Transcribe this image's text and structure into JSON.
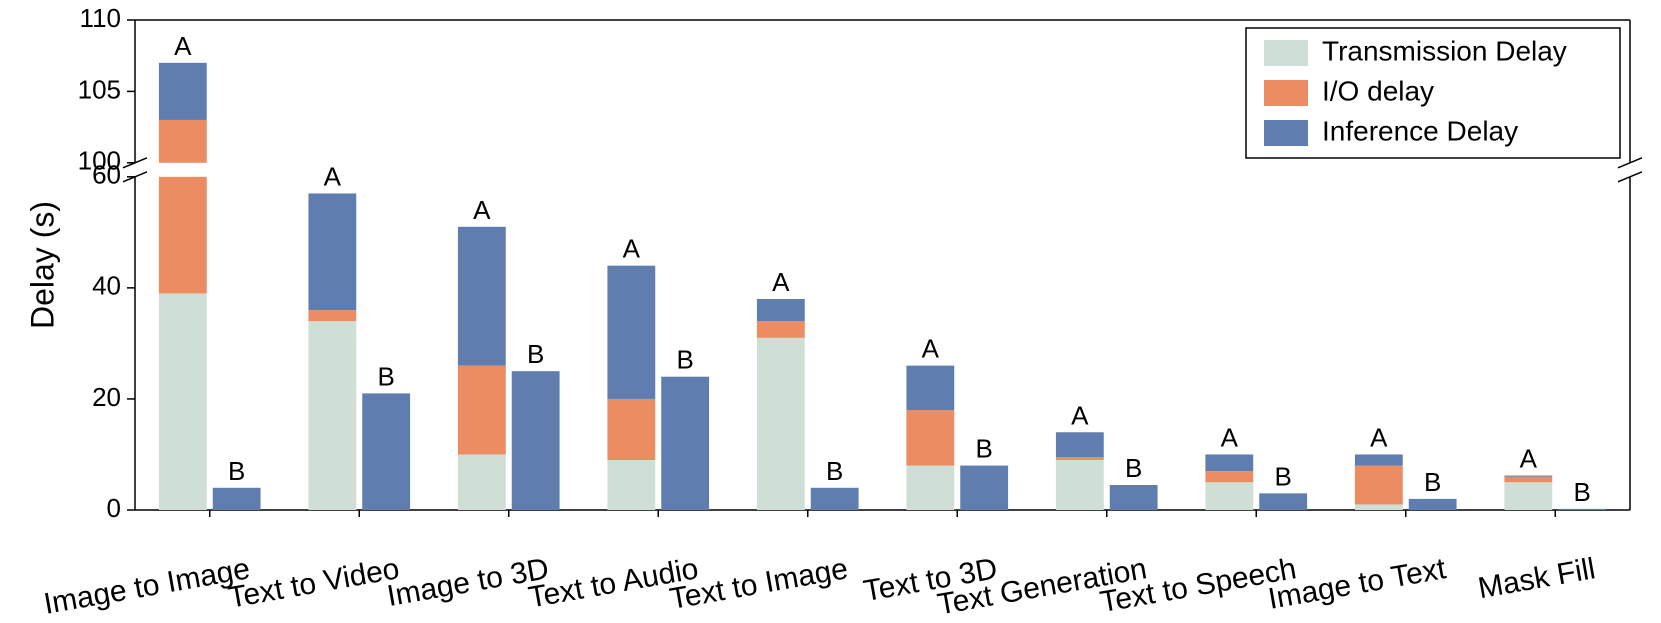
{
  "chart_data": {
    "type": "bar",
    "stacked": true,
    "ylabel": "Delay (s)",
    "xlabel": "",
    "group_labels": [
      "A",
      "B"
    ],
    "ylim_lower": [
      0,
      60
    ],
    "ylim_upper": [
      100,
      110
    ],
    "yticks_lower": [
      0,
      20,
      40,
      60
    ],
    "yticks_upper": [
      100,
      105,
      110
    ],
    "categories": [
      "Image to Image",
      "Text to Video",
      "Image to 3D",
      "Text to Audio",
      "Text to Image",
      "Text to 3D",
      "Text Generation",
      "Text to Speech",
      "Image to Text",
      "Mask Fill"
    ],
    "series": [
      {
        "name": "Transmission Delay",
        "color": "#cfdfd5"
      },
      {
        "name": "I/O delay",
        "color": "#eb8c63"
      },
      {
        "name": "Inference Delay",
        "color": "#5f7eaf"
      }
    ],
    "data": {
      "Image to Image": {
        "A": [
          39,
          64,
          4
        ],
        "B": [
          0,
          0,
          4
        ]
      },
      "Text to Video": {
        "A": [
          34,
          2,
          21
        ],
        "B": [
          0,
          0,
          21
        ]
      },
      "Image to 3D": {
        "A": [
          10,
          16,
          25
        ],
        "B": [
          0,
          0,
          25
        ]
      },
      "Text to Audio": {
        "A": [
          9,
          11,
          24
        ],
        "B": [
          0,
          0,
          24
        ]
      },
      "Text to Image": {
        "A": [
          31,
          3,
          4
        ],
        "B": [
          0,
          0,
          4
        ]
      },
      "Text to 3D": {
        "A": [
          8,
          10,
          8
        ],
        "B": [
          0,
          0,
          8
        ]
      },
      "Text Generation": {
        "A": [
          9,
          0.5,
          4.5
        ],
        "B": [
          0,
          0,
          4.5
        ]
      },
      "Text to Speech": {
        "A": [
          5,
          2,
          3
        ],
        "B": [
          0,
          0,
          3
        ]
      },
      "Image to Text": {
        "A": [
          1,
          7,
          2
        ],
        "B": [
          0,
          0,
          2
        ]
      },
      "Mask Fill": {
        "A": [
          5,
          1,
          0.2
        ],
        "B": [
          0,
          0,
          0.2
        ]
      }
    },
    "legend_position": "upper right"
  }
}
